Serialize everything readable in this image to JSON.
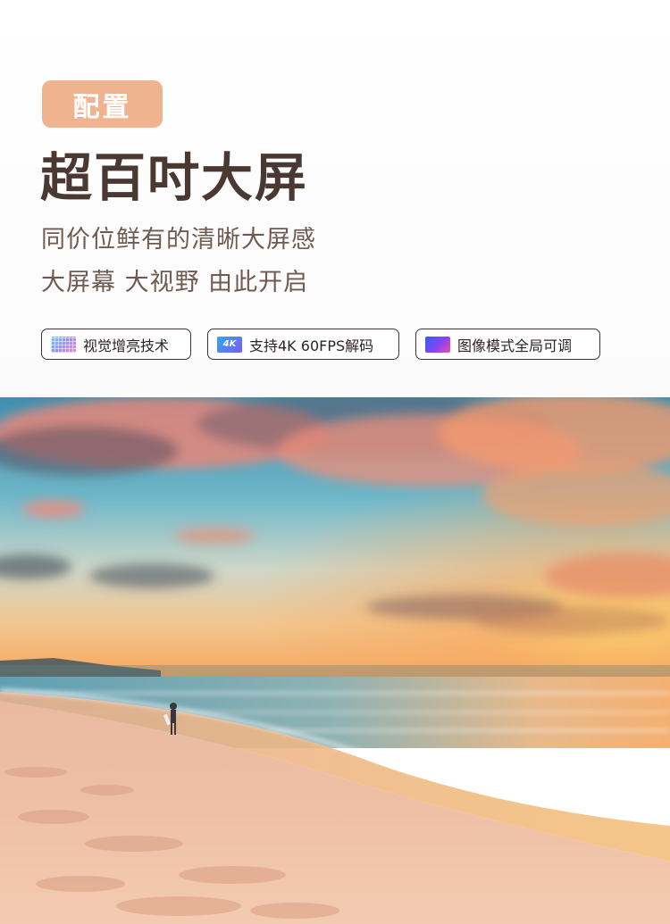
{
  "badge": {
    "label": "配置"
  },
  "heading": {
    "title": "超百吋大屏"
  },
  "subtitles": {
    "line1": "同价位鲜有的清晰大屏感",
    "line2": "大屏幕 大视野 由此开启"
  },
  "features": [
    {
      "icon": "pixel-grid-icon",
      "label": "视觉增亮技术"
    },
    {
      "icon": "4k-badge-icon",
      "icon_text": "4K",
      "label": "支持4K 60FPS解码"
    },
    {
      "icon": "color-mode-icon",
      "label": "图像模式全局可调"
    }
  ],
  "colors": {
    "badge_bg": "#efb48f",
    "title": "#4a3832",
    "subtitle": "#6f5a52"
  },
  "photo": {
    "subject": "sunset-beach-photo"
  }
}
